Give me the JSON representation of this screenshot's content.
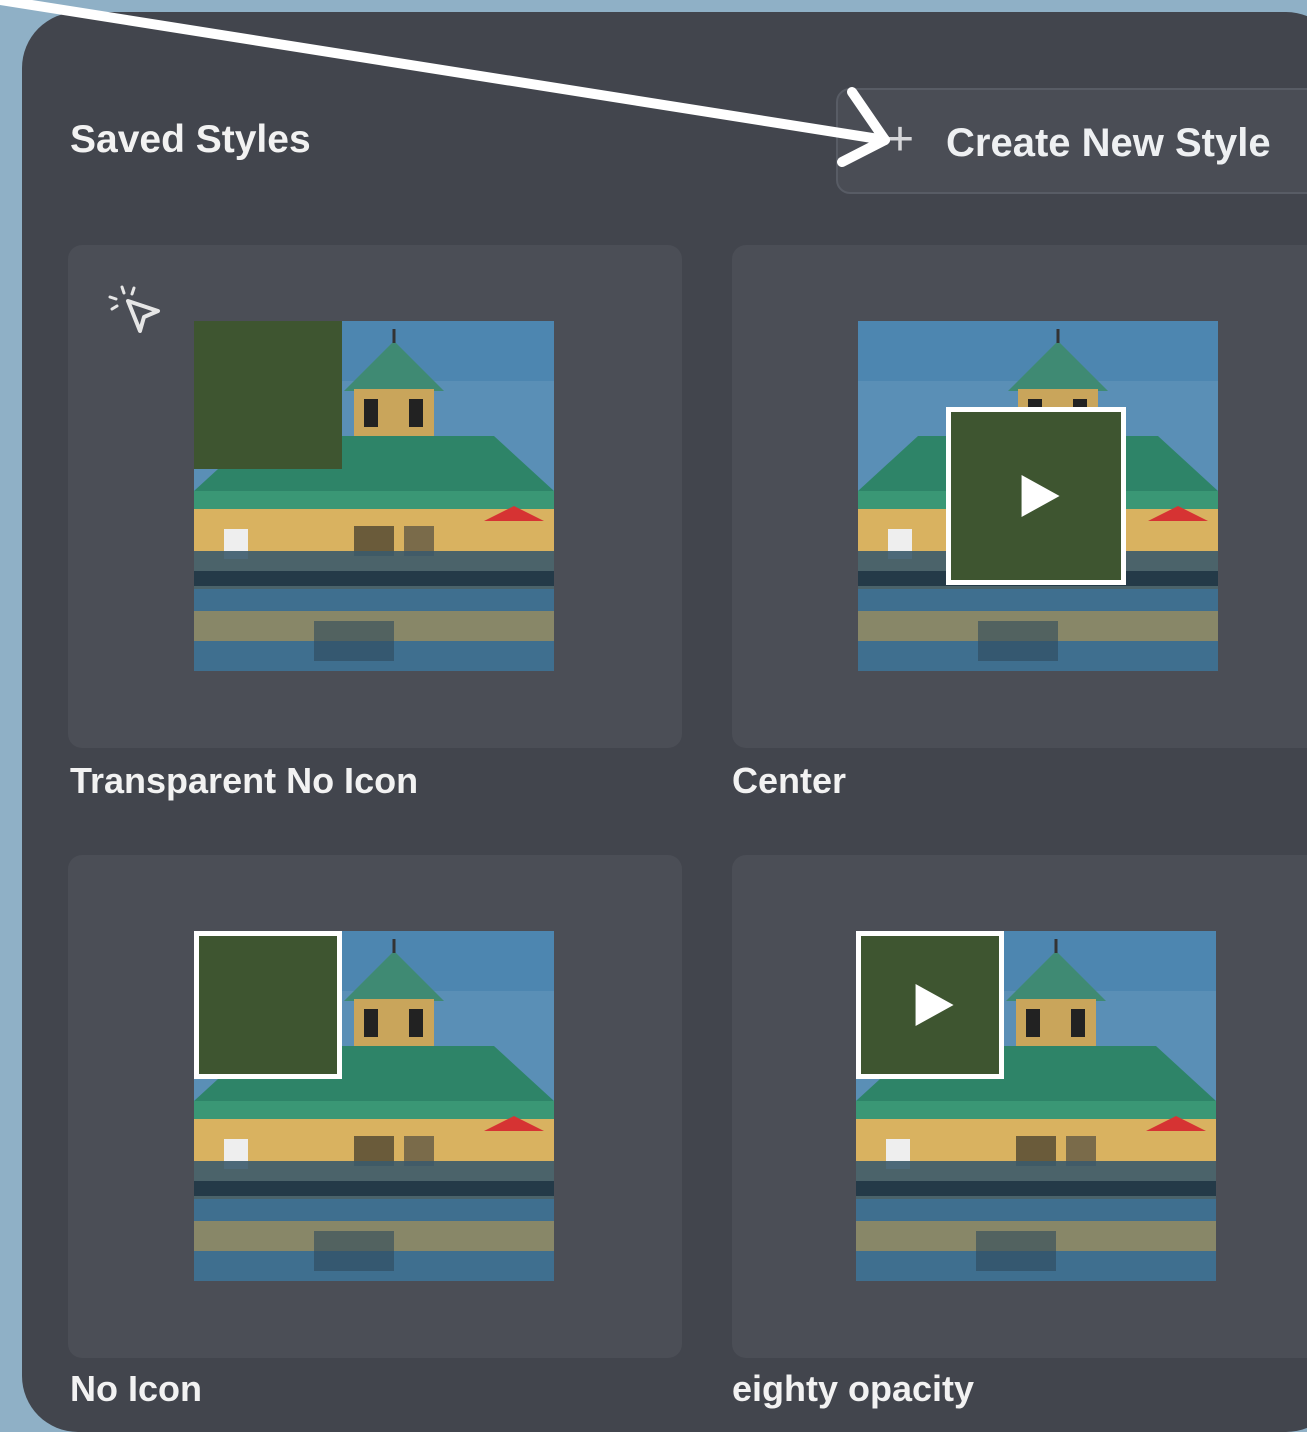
{
  "header": {
    "title": "Saved Styles",
    "create_button_icon": "plus-icon",
    "create_button_label": "Create New Style"
  },
  "styles": [
    {
      "name": "Transparent No Icon",
      "overlay": "transparent",
      "icon": "none"
    },
    {
      "name": "Center",
      "overlay": "center-box",
      "icon": "play-icon"
    },
    {
      "name": "No Icon",
      "overlay": "corner-box",
      "icon": "none"
    },
    {
      "name": "eighty opacity",
      "overlay": "corner-box",
      "icon": "play-icon"
    }
  ],
  "colors": {
    "background": "#8fb0c6",
    "panel": "#42454d",
    "card": "#4b4e56",
    "overlay_green": "#3e5530",
    "text": "#f2f2f2"
  }
}
